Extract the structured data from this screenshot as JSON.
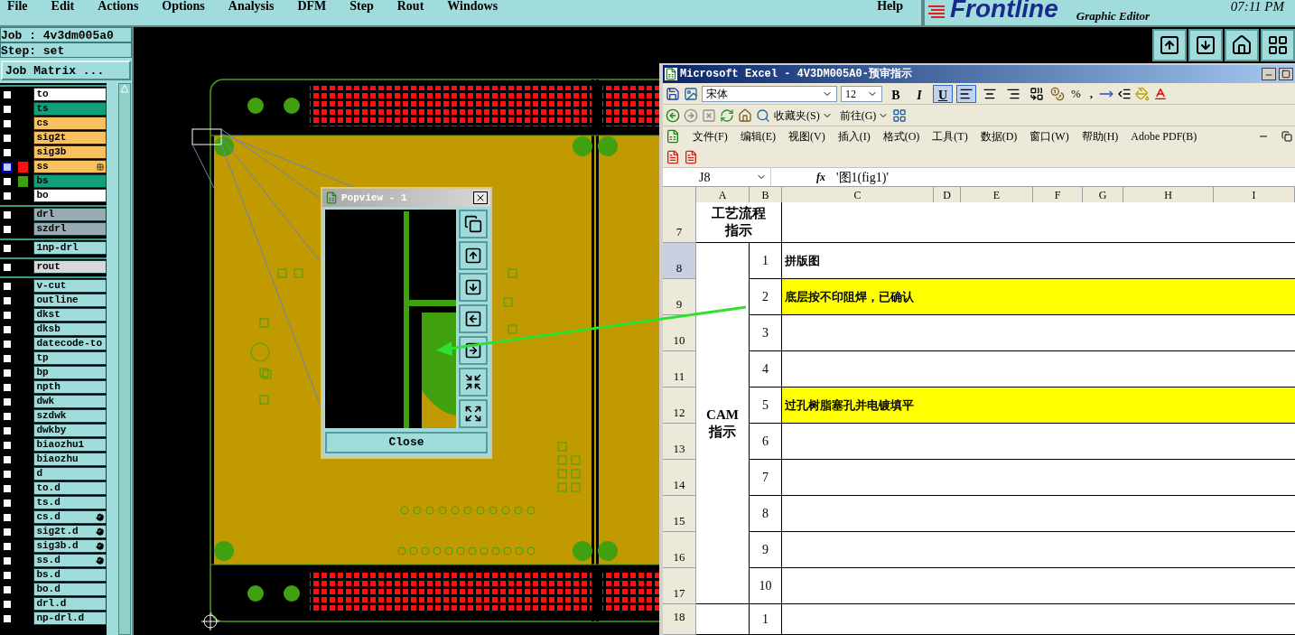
{
  "menu_bar": {
    "items": [
      "File",
      "Edit",
      "Actions",
      "Options",
      "Analysis",
      "DFM",
      "Step",
      "Rout",
      "Windows"
    ],
    "help": "Help"
  },
  "brand": {
    "logo": "Frontline",
    "subtitle": "Graphic Editor",
    "time": "07:11 PM"
  },
  "job_panel": {
    "job": "Job : 4v3dm005a0",
    "step": "Step: set",
    "matrix_button": "Job Matrix ..."
  },
  "layer_groups": [
    {
      "layers": [
        {
          "name": "to",
          "color": "#ffffff",
          "selected": false,
          "kind": "plain"
        },
        {
          "name": "ts",
          "color": "#12a07a",
          "selected": false,
          "kind": "plain"
        },
        {
          "name": "cs",
          "color": "#f8c060",
          "selected": false,
          "kind": "plain"
        },
        {
          "name": "sig2t",
          "color": "#f8c060",
          "selected": false,
          "kind": "plain"
        },
        {
          "name": "sig3b",
          "color": "#f8c060",
          "selected": false,
          "kind": "plain"
        },
        {
          "name": "ss",
          "color": "#f8c060",
          "selected": true,
          "swatch": {
            "color": "#ff1010"
          },
          "kind": "grid"
        },
        {
          "name": "bs",
          "color": "#12a07a",
          "selected": false,
          "swatch": {
            "color": "#40a010"
          },
          "kind": "plain"
        },
        {
          "name": "bo",
          "color": "#ffffff",
          "selected": false,
          "kind": "plain"
        }
      ]
    },
    {
      "layers": [
        {
          "name": "drl",
          "color": "#9aaab2",
          "selected": false,
          "kind": "plain"
        },
        {
          "name": "szdrl",
          "color": "#9aaab2",
          "selected": false,
          "kind": "plain"
        }
      ]
    },
    {
      "layers": [
        {
          "name": "1np-drl",
          "color": "#a0dcdc",
          "selected": false,
          "kind": "plain"
        }
      ]
    },
    {
      "layers": [
        {
          "name": "rout",
          "color": "#d8d8d8",
          "selected": false,
          "kind": "plain"
        }
      ]
    },
    {
      "layers": [
        {
          "name": "v-cut",
          "color": "#a0dcdc",
          "selected": false,
          "kind": "plain"
        },
        {
          "name": "outline",
          "color": "#a0dcdc",
          "selected": false,
          "kind": "plain"
        },
        {
          "name": "dkst",
          "color": "#a0dcdc",
          "selected": false,
          "kind": "plain"
        },
        {
          "name": "dksb",
          "color": "#a0dcdc",
          "selected": false,
          "kind": "plain"
        },
        {
          "name": "datecode-to",
          "color": "#a0dcdc",
          "selected": false,
          "kind": "plain"
        },
        {
          "name": "tp",
          "color": "#a0dcdc",
          "selected": false,
          "kind": "plain"
        },
        {
          "name": "bp",
          "color": "#a0dcdc",
          "selected": false,
          "kind": "plain"
        },
        {
          "name": "npth",
          "color": "#a0dcdc",
          "selected": false,
          "kind": "plain"
        },
        {
          "name": "dwk",
          "color": "#a0dcdc",
          "selected": false,
          "kind": "plain"
        },
        {
          "name": "szdwk",
          "color": "#a0dcdc",
          "selected": false,
          "kind": "plain"
        },
        {
          "name": "dwkby",
          "color": "#a0dcdc",
          "selected": false,
          "kind": "plain"
        },
        {
          "name": "biaozhu1",
          "color": "#a0dcdc",
          "selected": false,
          "kind": "plain"
        },
        {
          "name": "biaozhu",
          "color": "#a0dcdc",
          "selected": false,
          "kind": "plain"
        },
        {
          "name": "d",
          "color": "#a0dcdc",
          "selected": false,
          "kind": "plain"
        },
        {
          "name": "to.d",
          "color": "#a0dcdc",
          "selected": false,
          "kind": "plain"
        },
        {
          "name": "ts.d",
          "color": "#a0dcdc",
          "selected": false,
          "kind": "plain"
        },
        {
          "name": "cs.d",
          "color": "#a0dcdc",
          "selected": false,
          "kind": "hand"
        },
        {
          "name": "sig2t.d",
          "color": "#a0dcdc",
          "selected": false,
          "kind": "hand"
        },
        {
          "name": "sig3b.d",
          "color": "#a0dcdc",
          "selected": false,
          "kind": "hand"
        },
        {
          "name": "ss.d",
          "color": "#a0dcdc",
          "selected": false,
          "kind": "hand"
        },
        {
          "name": "bs.d",
          "color": "#a0dcdc",
          "selected": false,
          "kind": "plain"
        },
        {
          "name": "bo.d",
          "color": "#a0dcdc",
          "selected": false,
          "kind": "plain"
        },
        {
          "name": "drl.d",
          "color": "#a0dcdc",
          "selected": false,
          "kind": "plain"
        },
        {
          "name": "np-drl.d",
          "color": "#a0dcdc",
          "selected": false,
          "kind": "plain"
        }
      ]
    }
  ],
  "popview": {
    "title": "Popview - 1",
    "close": "Close"
  },
  "excel": {
    "title": "Microsoft Excel - 4V3DM005A0-预审指示",
    "font": "宋体",
    "size": "12",
    "style_buttons": [
      {
        "label": "B",
        "selected": false
      },
      {
        "label": "I",
        "selected": false
      },
      {
        "label": "U",
        "selected": true
      }
    ],
    "align_buttons": [
      {
        "selected": true
      },
      {
        "selected": false
      },
      {
        "selected": false
      },
      {
        "selected": false
      }
    ],
    "percent": "%",
    "comma": ",",
    "favorites": "收藏夹(S)",
    "go": "前往(G)",
    "menu": [
      "文件(F)",
      "编辑(E)",
      "视图(V)",
      "插入(I)",
      "格式(O)",
      "工具(T)",
      "数据(D)",
      "窗口(W)",
      "帮助(H)",
      "Adobe PDF(B)"
    ],
    "name_box": "J8",
    "fx": "fx",
    "formula": "'图1(fig1)'",
    "columns": [
      "A",
      "B",
      "C",
      "D",
      "E",
      "F",
      "G",
      "H",
      "I"
    ],
    "row_headers": [
      {
        "label": "7",
        "selected": false
      },
      {
        "label": "8",
        "selected": true
      },
      {
        "label": "9",
        "selected": false
      },
      {
        "label": "10",
        "selected": false
      },
      {
        "label": "11",
        "selected": false
      },
      {
        "label": "12",
        "selected": false
      },
      {
        "label": "13",
        "selected": false
      },
      {
        "label": "14",
        "selected": false
      },
      {
        "label": "15",
        "selected": false
      },
      {
        "label": "16",
        "selected": false
      },
      {
        "label": "17",
        "selected": false
      },
      {
        "label": "18",
        "selected": false
      }
    ],
    "sections": [
      {
        "title_lines": [
          "工艺流程",
          "指示"
        ]
      },
      {
        "title_lines": [
          "CAM",
          "指示"
        ],
        "steps": [
          {
            "no": "1",
            "text": "拼版图",
            "highlight": false
          },
          {
            "no": "2",
            "text": "底层按不印阻焊，已确认",
            "highlight": true
          },
          {
            "no": "3",
            "highlight": false
          },
          {
            "no": "4",
            "highlight": false
          },
          {
            "no": "5",
            "text": "过孔树脂塞孔并电镀填平",
            "highlight": true
          },
          {
            "no": "6",
            "highlight": false
          },
          {
            "no": "7",
            "highlight": false
          },
          {
            "no": "8",
            "highlight": false
          },
          {
            "no": "9",
            "highlight": false
          },
          {
            "no": "10",
            "highlight": false
          }
        ]
      },
      {
        "steps": [
          {
            "no": "1",
            "highlight": false
          }
        ]
      }
    ]
  }
}
